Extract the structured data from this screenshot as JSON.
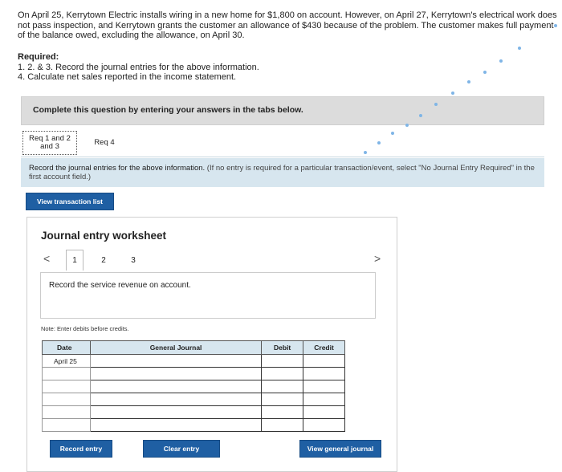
{
  "problem": {
    "text": "On April 25, Kerrytown Electric installs wiring in a new home for $1,800 on account. However, on April 27, Kerrytown's electrical work does not pass inspection, and Kerrytown grants the customer an allowance of $430 because of the problem. The customer makes full payment of the balance owed, excluding the allowance, on April 30."
  },
  "required": {
    "title": "Required:",
    "item1": "1. 2. & 3. Record the journal entries for the above information.",
    "item2": "4. Calculate net sales reported in the income statement."
  },
  "banner": "Complete this question by entering your answers in the tabs below.",
  "tabs": [
    {
      "label": "Req 1 and 2 and 3"
    },
    {
      "label": "Req 4"
    }
  ],
  "instruction": {
    "main": "Record the journal entries for the above information.",
    "note": "(If no entry is required for a particular transaction/event, select \"No Journal Entry Required\" in the first account field.)"
  },
  "buttons": {
    "view_transaction_list": "View transaction list",
    "record_entry": "Record entry",
    "clear_entry": "Clear entry",
    "view_general_journal": "View general journal"
  },
  "worksheet": {
    "title": "Journal entry worksheet",
    "nav": {
      "prev": "<",
      "next": ">",
      "pages": [
        "1",
        "2",
        "3"
      ],
      "current": "1"
    },
    "description": "Record the service revenue on account.",
    "note": "Note: Enter debits before credits.",
    "columns": [
      "Date",
      "General Journal",
      "Debit",
      "Credit"
    ],
    "rows": [
      {
        "date": "April 25",
        "account": "",
        "debit": "",
        "credit": ""
      },
      {
        "date": "",
        "account": "",
        "debit": "",
        "credit": ""
      },
      {
        "date": "",
        "account": "",
        "debit": "",
        "credit": ""
      },
      {
        "date": "",
        "account": "",
        "debit": "",
        "credit": ""
      },
      {
        "date": "",
        "account": "",
        "debit": "",
        "credit": ""
      },
      {
        "date": "",
        "account": "",
        "debit": "",
        "credit": ""
      }
    ]
  },
  "colors": {
    "accent": "#1f5fa3",
    "header_bg": "#d7e6ef",
    "banner_bg": "#dcdcdc"
  }
}
